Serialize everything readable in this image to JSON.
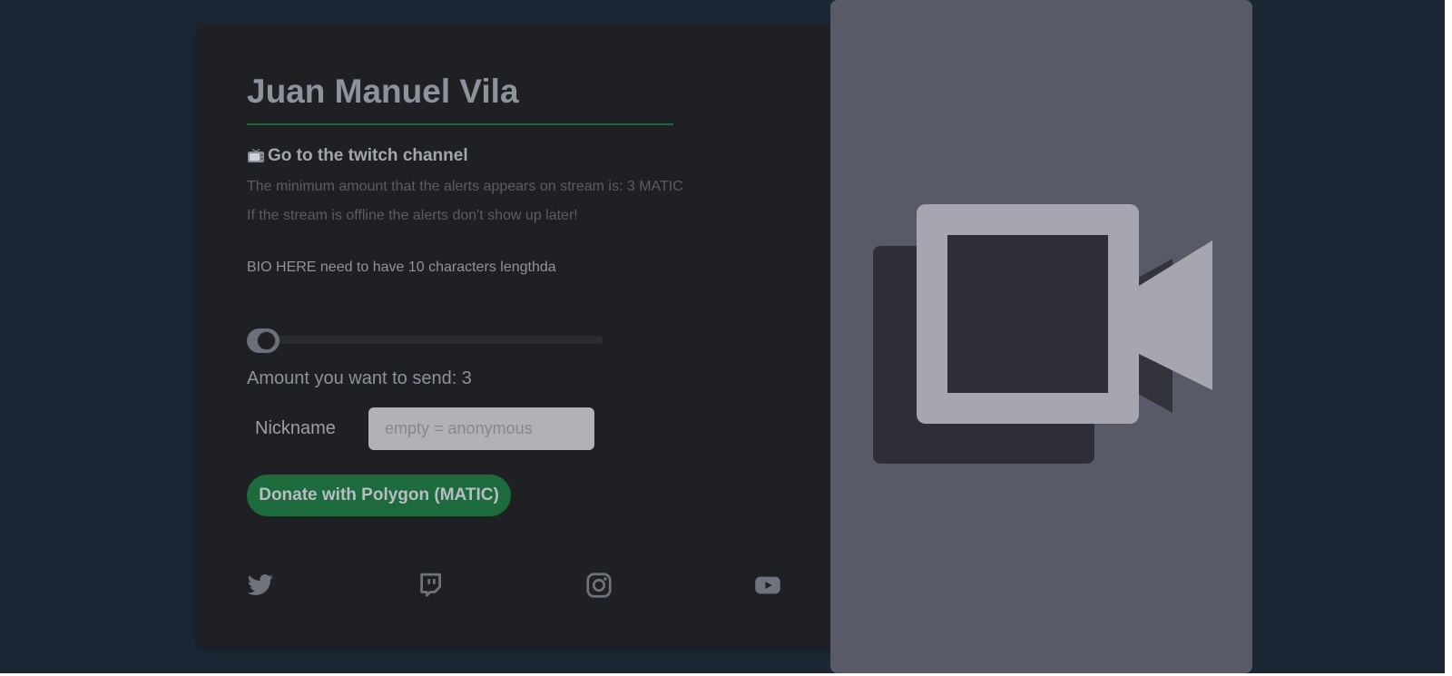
{
  "profile": {
    "name": "Juan Manuel Vila",
    "twitch_link_label": "Go to the twitch channel",
    "min_amount_text": "The minimum amount that the alerts appears on stream is: 3 MATIC",
    "offline_text": "If the stream is offline the alerts don't show up later!",
    "bio": "BIO HERE need to have 10 characters lengthda"
  },
  "donation": {
    "amount_text": "Amount you want to send: 3",
    "amount_slider_fraction": 0.0,
    "nickname_label": "Nickname",
    "nickname_value": "",
    "nickname_placeholder": "empty = anonymous",
    "donate_button_label": "Donate with Polygon (MATIC)"
  },
  "social": {
    "icons": [
      "twitter-icon",
      "twitch-icon",
      "instagram-icon",
      "youtube-icon"
    ]
  },
  "video": {
    "icon": "video-camera-icon"
  },
  "colors": {
    "page_bg": "#1c2735",
    "card_bg": "#1f2023",
    "accent_green": "#1d6b3c",
    "video_panel_bg": "#595a67"
  }
}
